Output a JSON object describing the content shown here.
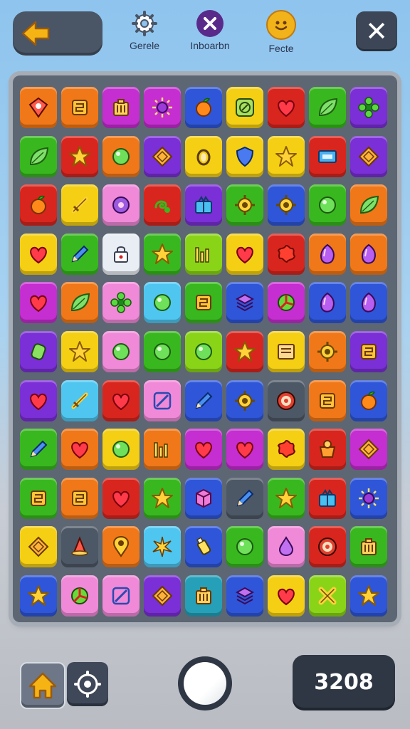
{
  "header": {
    "items": [
      {
        "label": "Gerele",
        "icon": "gear-icon"
      },
      {
        "label": "Inboarbn",
        "icon": "close-circle-icon"
      },
      {
        "label": "Fecte",
        "icon": "smiley-face-icon"
      }
    ],
    "back_icon": "arrow-left-icon",
    "close_icon": "close-icon",
    "close_glyph": "✕"
  },
  "board": {
    "columns": 9,
    "rows": 11,
    "tiles": [
      [
        "orange",
        "red-badge"
      ],
      [
        "orange",
        "square-rune"
      ],
      [
        "magenta",
        "box"
      ],
      [
        "magenta",
        "sun"
      ],
      [
        "blue",
        "fruit"
      ],
      [
        "yellow",
        "compass"
      ],
      [
        "red",
        "heart"
      ],
      [
        "green",
        "leaf"
      ],
      [
        "purple",
        "flower"
      ],
      [
        "green",
        "leaf"
      ],
      [
        "red",
        "star"
      ],
      [
        "orange",
        "orb"
      ],
      [
        "purple",
        "diamond"
      ],
      [
        "yellow",
        "ring"
      ],
      [
        "yellow",
        "shield"
      ],
      [
        "yellow",
        "star"
      ],
      [
        "red",
        "rectangle"
      ],
      [
        "purple",
        "diamond"
      ],
      [
        "red",
        "fruit"
      ],
      [
        "yellow",
        "sword"
      ],
      [
        "pink",
        "donut"
      ],
      [
        "red",
        "swirl"
      ],
      [
        "purple",
        "gift"
      ],
      [
        "green",
        "gear"
      ],
      [
        "blue",
        "gear"
      ],
      [
        "green",
        "orb"
      ],
      [
        "orange",
        "leaf"
      ],
      [
        "yellow",
        "heart"
      ],
      [
        "green",
        "pencil"
      ],
      [
        "white",
        "lock"
      ],
      [
        "green",
        "star"
      ],
      [
        "lime",
        "bars"
      ],
      [
        "yellow",
        "heart"
      ],
      [
        "red",
        "splat"
      ],
      [
        "orange",
        "gem"
      ],
      [
        "orange",
        "gem"
      ],
      [
        "magenta",
        "heart"
      ],
      [
        "orange",
        "leaf"
      ],
      [
        "pink",
        "flower"
      ],
      [
        "cyan",
        "orb"
      ],
      [
        "green",
        "square-rune"
      ],
      [
        "blue",
        "stack"
      ],
      [
        "magenta",
        "pizza"
      ],
      [
        "blue",
        "gem"
      ],
      [
        "blue",
        "gem"
      ],
      [
        "purple",
        "cylinder"
      ],
      [
        "yellow",
        "star"
      ],
      [
        "pink",
        "orb"
      ],
      [
        "green",
        "orb"
      ],
      [
        "lime",
        "orb"
      ],
      [
        "red",
        "star"
      ],
      [
        "yellow",
        "book"
      ],
      [
        "orange",
        "gear"
      ],
      [
        "purple",
        "square-rune"
      ],
      [
        "purple",
        "heart"
      ],
      [
        "cyan",
        "sword"
      ],
      [
        "red",
        "heart"
      ],
      [
        "pink",
        "slash"
      ],
      [
        "blue",
        "pencil"
      ],
      [
        "blue",
        "gear"
      ],
      [
        "gray",
        "target"
      ],
      [
        "orange",
        "square-rune"
      ],
      [
        "blue",
        "fruit"
      ],
      [
        "green",
        "pencil"
      ],
      [
        "orange",
        "heart"
      ],
      [
        "yellow",
        "orb"
      ],
      [
        "orange",
        "bars"
      ],
      [
        "magenta",
        "heart"
      ],
      [
        "magenta",
        "heart"
      ],
      [
        "yellow",
        "splat"
      ],
      [
        "red",
        "pot"
      ],
      [
        "magenta",
        "diamond"
      ],
      [
        "green",
        "square-rune"
      ],
      [
        "orange",
        "square-rune"
      ],
      [
        "red",
        "heart"
      ],
      [
        "green",
        "star"
      ],
      [
        "blue",
        "cube"
      ],
      [
        "gray",
        "pencil"
      ],
      [
        "green",
        "star"
      ],
      [
        "red",
        "gift"
      ],
      [
        "blue",
        "sun"
      ],
      [
        "yellow",
        "diamond"
      ],
      [
        "gray",
        "cone"
      ],
      [
        "orange",
        "pin"
      ],
      [
        "cyan",
        "spark"
      ],
      [
        "blue",
        "bottle"
      ],
      [
        "green",
        "orb"
      ],
      [
        "pink",
        "drop"
      ],
      [
        "red",
        "target"
      ],
      [
        "green",
        "box"
      ],
      [
        "blue",
        "star"
      ],
      [
        "pink",
        "pizza"
      ],
      [
        "pink",
        "slash"
      ],
      [
        "purple",
        "diamond"
      ],
      [
        "teal",
        "box"
      ],
      [
        "blue",
        "stack"
      ],
      [
        "yellow",
        "heart"
      ],
      [
        "lime",
        "cross"
      ],
      [
        "blue",
        "star"
      ]
    ]
  },
  "palette": {
    "orange": "#f07818",
    "red": "#d8261e",
    "magenta": "#c52ed0",
    "blue": "#2f56d8",
    "yellow": "#f4cf14",
    "green": "#38b81e",
    "purple": "#7b2fd6",
    "pink": "#f08ad8",
    "white": "#e9eef4",
    "cyan": "#4fc6f0",
    "lime": "#8ad418",
    "gray": "#4d5866",
    "teal": "#26a0b8"
  },
  "footer": {
    "home_icon": "home-icon",
    "settings_icon": "settings-gear-icon",
    "score": "3208"
  }
}
